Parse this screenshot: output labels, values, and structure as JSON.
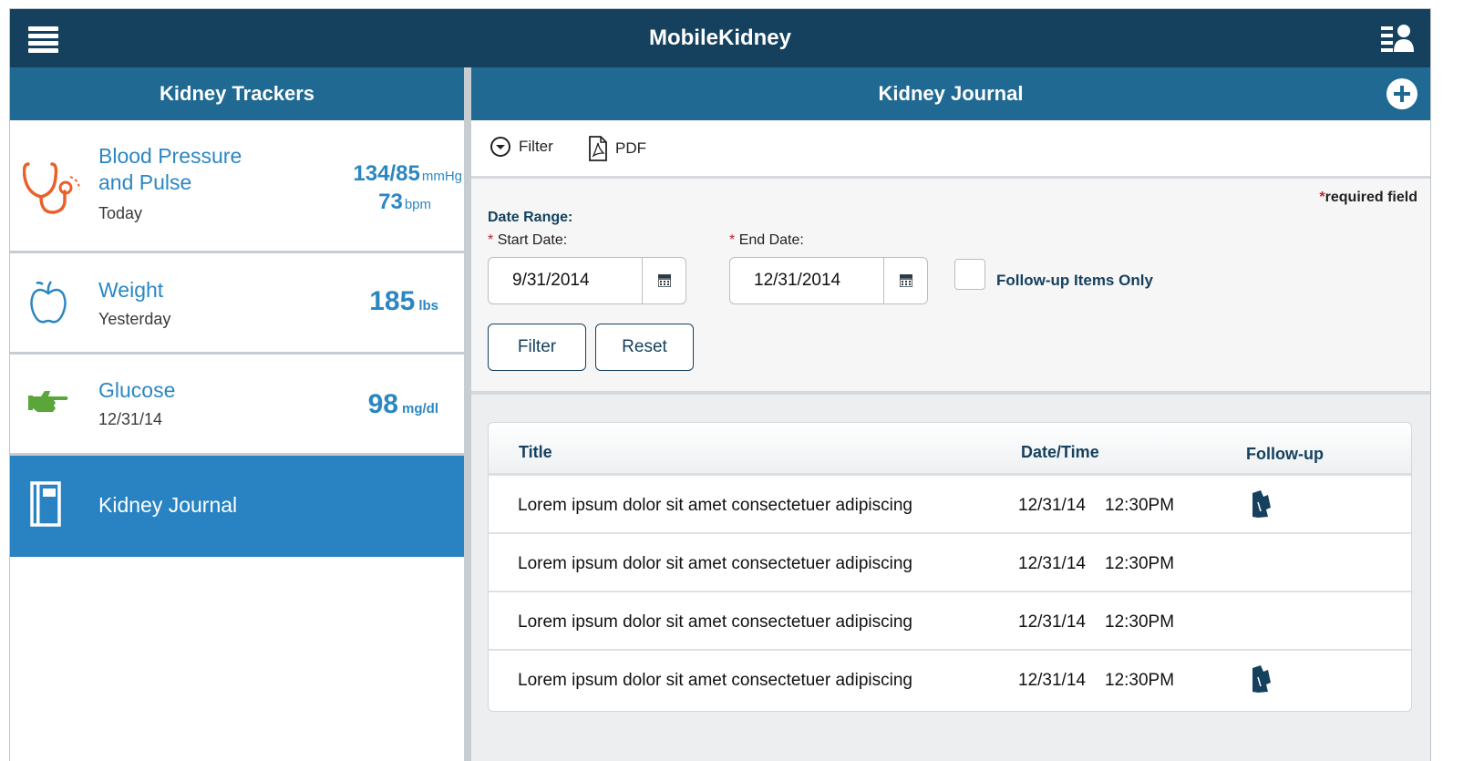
{
  "app": {
    "title": "MobileKidney"
  },
  "trackers_panel": {
    "title": "Kidney Trackers",
    "items": [
      {
        "name_line1": "Blood Pressure",
        "name_line2": "and Pulse",
        "date": "Today",
        "value1": "134/85",
        "unit1": "mmHg",
        "value2": "73",
        "unit2": "bpm",
        "icon": "stethoscope-icon"
      },
      {
        "name": "Weight",
        "date": "Yesterday",
        "value": "185",
        "unit": "lbs",
        "icon": "apple-icon"
      },
      {
        "name": "Glucose",
        "date": "12/31/14",
        "value": "98",
        "unit": "mg/dl",
        "icon": "pointing-hand-icon"
      }
    ],
    "journal": {
      "label": "Kidney Journal",
      "icon": "journal-book-icon"
    }
  },
  "journal_panel": {
    "title": "Kidney Journal",
    "toolbar": {
      "filter_label": "Filter",
      "pdf_label": "PDF"
    },
    "filter": {
      "required_star": "*",
      "required_note": "required field",
      "date_range_label": "Date Range:",
      "start_label": "Start Date:",
      "start_value": "9/31/2014",
      "end_label": "End Date:",
      "end_value": "12/31/2014",
      "followup_label": "Follow-up Items Only",
      "followup_checked": false,
      "filter_button": "Filter",
      "reset_button": "Reset"
    },
    "table": {
      "headers": {
        "title": "Title",
        "datetime": "Date/Time",
        "followup": "Follow-up"
      },
      "rows": [
        {
          "title": "Lorem ipsum dolor sit amet consectetuer adipiscing",
          "date": "12/31/14",
          "time": "12:30PM",
          "followup": true
        },
        {
          "title": "Lorem ipsum dolor sit amet consectetuer adipiscing",
          "date": "12/31/14",
          "time": "12:30PM",
          "followup": false
        },
        {
          "title": "Lorem ipsum dolor sit amet consectetuer adipiscing",
          "date": "12/31/14",
          "time": "12:30PM",
          "followup": false
        },
        {
          "title": "Lorem ipsum dolor sit amet consectetuer adipiscing",
          "date": "12/31/14",
          "time": "12:30PM",
          "followup": true
        }
      ]
    }
  },
  "colors": {
    "topbar": "#15415f",
    "header": "#1f6993",
    "accent": "#2b87c2",
    "selected": "#2983c2",
    "required": "#c0282d",
    "stethoscope": "#e8612c",
    "glucose": "#5aa63a"
  }
}
